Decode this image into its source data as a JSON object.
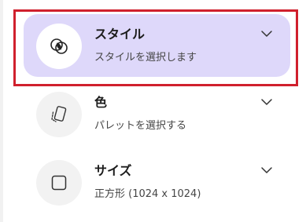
{
  "options": [
    {
      "title": "スタイル",
      "subtitle": "スタイルを選択します",
      "icon": "style-overlap-circles-icon",
      "selected": true
    },
    {
      "title": "色",
      "subtitle": "パレットを選択する",
      "icon": "palette-swatch-icon",
      "selected": false
    },
    {
      "title": "サイズ",
      "subtitle": "正方形 (1024 x 1024)",
      "icon": "square-icon",
      "selected": false
    }
  ],
  "colors": {
    "selected_background": "#ded8fa",
    "highlight_border": "#d0202d",
    "icon_circle": "#f2f2f2"
  }
}
